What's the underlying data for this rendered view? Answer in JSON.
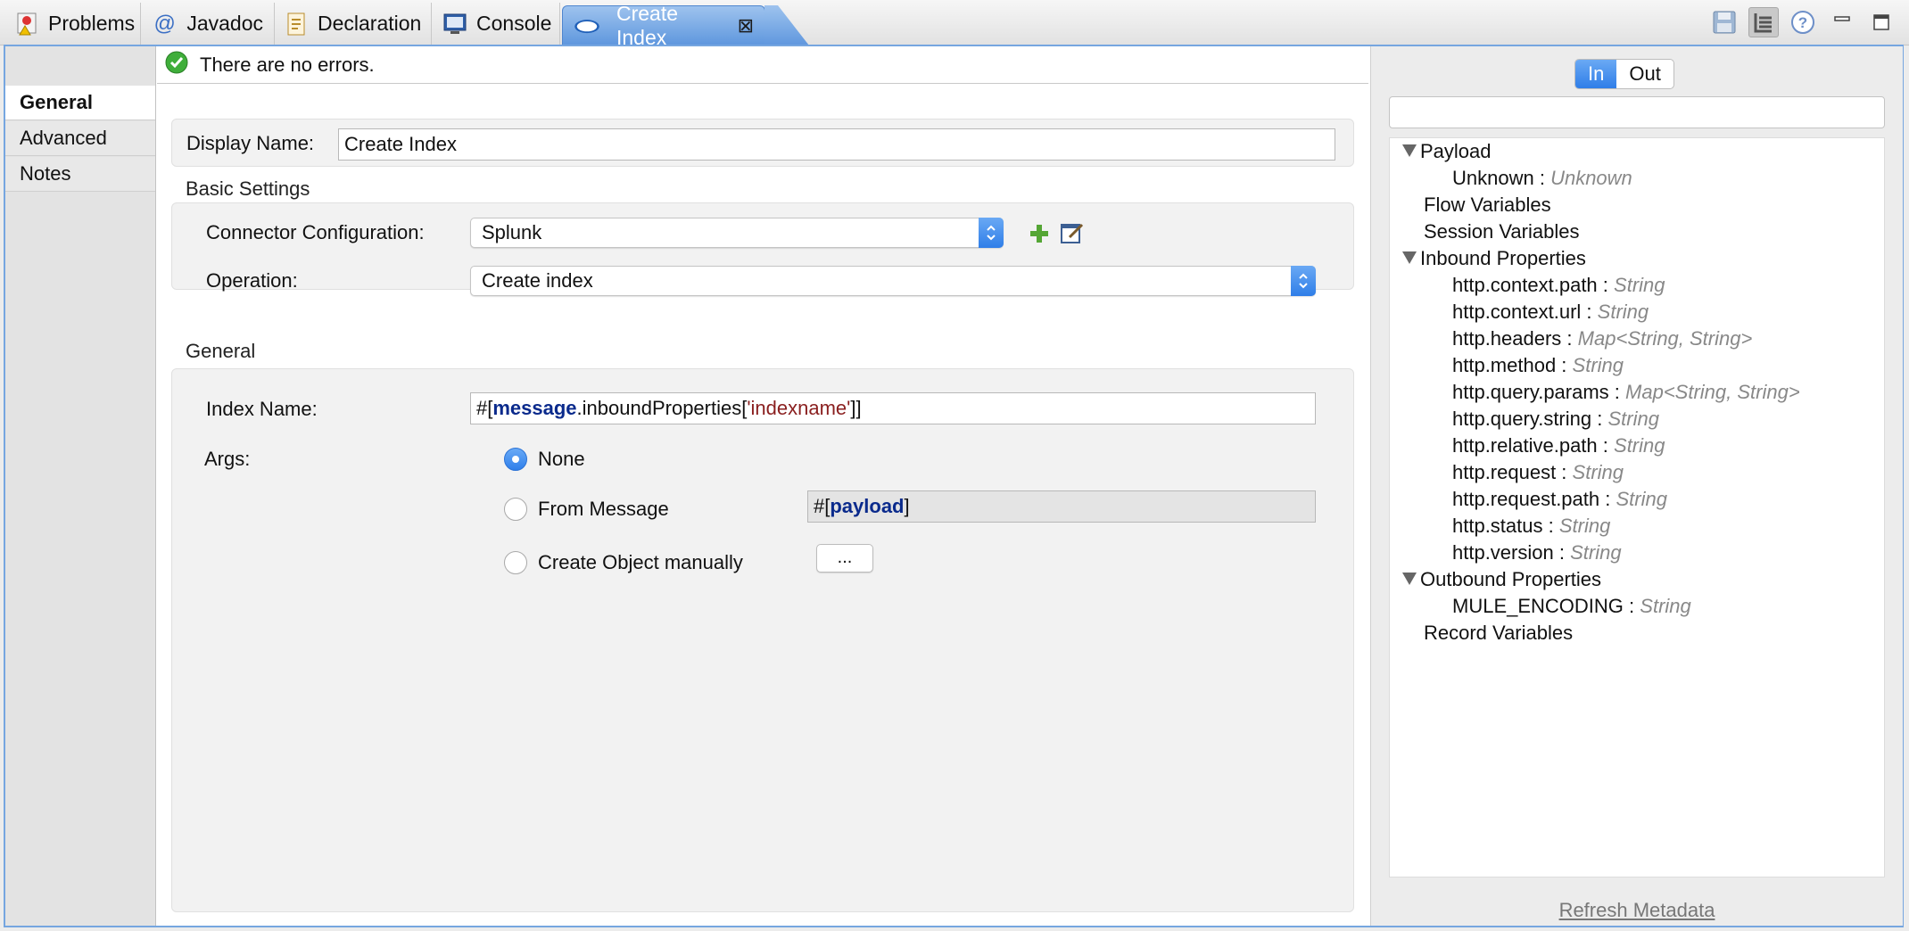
{
  "tabs": [
    {
      "label": "Problems",
      "icon": "problems-icon"
    },
    {
      "label": "Javadoc",
      "icon": "javadoc-at-icon"
    },
    {
      "label": "Declaration",
      "icon": "declaration-icon"
    },
    {
      "label": "Console",
      "icon": "console-icon"
    },
    {
      "label": "Create Index",
      "icon": "cloud-icon",
      "close": "⊠"
    }
  ],
  "side_tabs": [
    "General",
    "Advanced",
    "Notes"
  ],
  "status": {
    "text": "There are no errors."
  },
  "display_name": {
    "label": "Display Name:",
    "value": "Create Index"
  },
  "basic_settings": {
    "title": "Basic Settings",
    "connector_label": "Connector Configuration:",
    "connector_value": "Splunk",
    "operation_label": "Operation:",
    "operation_value": "Create index"
  },
  "general": {
    "title": "General",
    "index_label": "Index Name:",
    "index_value": {
      "prefix": "#[",
      "kw": "message",
      "mid": ".inboundProperties[",
      "str": "'indexname'",
      "suffix": "]]"
    },
    "args_label": "Args:",
    "radio_none": "None",
    "radio_from_message": "From Message",
    "radio_create_object": "Create Object manually",
    "from_message_value": {
      "prefix": "#[",
      "kw": "payload",
      "suffix": "]"
    },
    "ellipsis_button": "..."
  },
  "right_panel": {
    "segment_in": "In",
    "segment_out": "Out",
    "tree": {
      "payload": "Payload",
      "payload_child": {
        "name": "Unknown :",
        "type": "Unknown"
      },
      "flow_vars": "Flow Variables",
      "session_vars": "Session Variables",
      "inbound": "Inbound Properties",
      "inbound_items": [
        {
          "name": "http.context.path :",
          "type": "String"
        },
        {
          "name": "http.context.url :",
          "type": "String"
        },
        {
          "name": "http.headers :",
          "type": "Map<String, String>"
        },
        {
          "name": "http.method :",
          "type": "String"
        },
        {
          "name": "http.query.params :",
          "type": "Map<String, String>"
        },
        {
          "name": "http.query.string :",
          "type": "String"
        },
        {
          "name": "http.relative.path :",
          "type": "String"
        },
        {
          "name": "http.request :",
          "type": "String"
        },
        {
          "name": "http.request.path :",
          "type": "String"
        },
        {
          "name": "http.status :",
          "type": "String"
        },
        {
          "name": "http.version :",
          "type": "String"
        }
      ],
      "outbound": "Outbound Properties",
      "outbound_items": [
        {
          "name": "MULE_ENCODING :",
          "type": "String"
        }
      ],
      "record_vars": "Record Variables"
    },
    "refresh": "Refresh Metadata"
  },
  "colors": {
    "accent": "#3d86ea",
    "tab_active": "#5f97de",
    "ok_green": "#3fae3a",
    "string_red": "#8a1f1f",
    "keyword_blue": "#0a2a8c"
  }
}
